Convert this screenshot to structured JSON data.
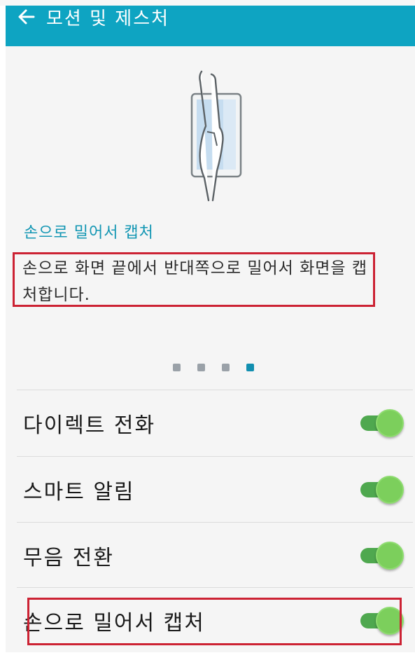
{
  "app_bar": {
    "title": "모션 및 제스처",
    "back_icon": "arrow-left-icon",
    "color": "#0ea4c2"
  },
  "feature": {
    "title": "손으로 밀어서 캡처",
    "description": "손으로 화면 끝에서 반대쪽으로 밀어서 화면을 캡처합니다.",
    "illustration_icon": "palm-swipe-capture-icon"
  },
  "pager": {
    "count": 4,
    "active_index": 3
  },
  "settings": [
    {
      "label": "다이렉트 전화",
      "enabled": true
    },
    {
      "label": "스마트 알림",
      "enabled": true
    },
    {
      "label": "무음 전환",
      "enabled": true
    },
    {
      "label": "손으로 밀어서 캡처",
      "enabled": true
    }
  ],
  "accent_colors": {
    "toggle_on": "#7ccf5c",
    "highlight": "#cc2233",
    "title": "#1296b3"
  }
}
